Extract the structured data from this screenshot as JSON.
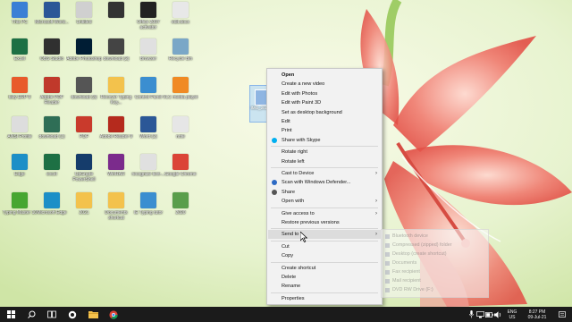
{
  "desktop_icons": [
    {
      "label": "This PC",
      "icon": "computer-icon",
      "color": "#3a7fd5"
    },
    {
      "label": "Microsoft Word...",
      "icon": "word-doc-icon",
      "color": "#2b5797"
    },
    {
      "label": "Untitled",
      "icon": "document-icon",
      "color": "#d0d0d0"
    },
    {
      "label": "",
      "icon": "keyboard-icon",
      "color": "#333333"
    },
    {
      "label": "Office 2007 activator",
      "icon": "archive-icon",
      "color": "#222222"
    },
    {
      "label": "edit.docx",
      "icon": "document-icon",
      "color": "#e8e8e8"
    },
    {
      "label": "Excel",
      "icon": "excel-icon",
      "color": "#1d7044"
    },
    {
      "label": "OBS Studio",
      "icon": "obs-icon",
      "color": "#303030"
    },
    {
      "label": "Adobe Photoshop",
      "icon": "photoshop-icon",
      "color": "#001d34"
    },
    {
      "label": "download (2)",
      "icon": "mouse-icon",
      "color": "#444444"
    },
    {
      "label": "Browser",
      "icon": "document-icon",
      "color": "#e0e0e0"
    },
    {
      "label": "Recycle Bin",
      "icon": "recycle-bin-icon",
      "color": "#7aa7c7"
    },
    {
      "label": "tally ERP 9",
      "icon": "tally-icon",
      "color": "#e85a2b"
    },
    {
      "label": "Adobe PDF Reader",
      "icon": "pdf-icon",
      "color": "#c0392b"
    },
    {
      "label": "download (3)",
      "icon": "printer-icon",
      "color": "#555555"
    },
    {
      "label": "Recover Typing Key...",
      "icon": "disk-icon",
      "color": "#f3c24c"
    },
    {
      "label": "Control Panel",
      "icon": "control-panel-icon",
      "color": "#3b8ed0"
    },
    {
      "label": "VLC media player",
      "icon": "vlc-icon",
      "color": "#f08a24"
    },
    {
      "label": "ANSI Profile",
      "icon": "document-icon",
      "color": "#dddddd"
    },
    {
      "label": "download (1)",
      "icon": "monitor-icon",
      "color": "#2f6e56"
    },
    {
      "label": "PDF",
      "icon": "pdf-icon",
      "color": "#c93a2c"
    },
    {
      "label": "Adobe Reader 9",
      "icon": "adobe-icon",
      "color": "#b52a1d"
    },
    {
      "label": "Word (2)",
      "icon": "word-doc-icon",
      "color": "#2b5797"
    },
    {
      "label": "note",
      "icon": "document-icon",
      "color": "#e6e6e6"
    },
    {
      "label": "Edge",
      "icon": "edge-icon",
      "color": "#1c8fc7"
    },
    {
      "label": "excel",
      "icon": "excel-icon",
      "color": "#1d7044"
    },
    {
      "label": "UpGrade PowerShell",
      "icon": "powershell-icon",
      "color": "#153c6b"
    },
    {
      "label": "WinRAR",
      "icon": "winrar-icon",
      "color": "#7b2b8c"
    },
    {
      "label": "recognize text-...",
      "icon": "document-icon",
      "color": "#e0e0e0"
    },
    {
      "label": "Google Chrome",
      "icon": "chrome-icon",
      "color": "#db4437"
    },
    {
      "label": "Typing Master 10",
      "icon": "typing-master-icon",
      "color": "#47a631"
    },
    {
      "label": "Microsoft Edge",
      "icon": "edge-icon",
      "color": "#1c8fc7"
    },
    {
      "label": "2021",
      "icon": "document-icon",
      "color": "#f3c24c"
    },
    {
      "label": "Documents shortcut",
      "icon": "folder-icon",
      "color": "#f3c24c"
    },
    {
      "label": "IE Typing tutor",
      "icon": "typing-tutor-icon",
      "color": "#3b8ed0"
    },
    {
      "label": "2020",
      "icon": "image-icon",
      "color": "#5a9e4b"
    }
  ],
  "selected_file": {
    "label": "IMG_2021..."
  },
  "context_menu": {
    "items": [
      {
        "label": "Open",
        "bold": true
      },
      {
        "label": "Create a new video"
      },
      {
        "label": "Edit with Photos"
      },
      {
        "label": "Edit with Paint 3D"
      },
      {
        "label": "Set as desktop background"
      },
      {
        "label": "Edit"
      },
      {
        "label": "Print"
      },
      {
        "label": "Share with Skype",
        "icon_color": "#00aff0"
      },
      {
        "sep": true
      },
      {
        "label": "Rotate right"
      },
      {
        "label": "Rotate left"
      },
      {
        "sep": true
      },
      {
        "label": "Cast to Device",
        "arrow": true
      },
      {
        "label": "Scan with Windows Defender...",
        "icon_color": "#2d6ac4"
      },
      {
        "label": "Share",
        "icon_color": "#555555"
      },
      {
        "label": "Open with",
        "arrow": true
      },
      {
        "sep": true
      },
      {
        "label": "Give access to",
        "arrow": true
      },
      {
        "label": "Restore previous versions"
      },
      {
        "sep": true
      },
      {
        "label": "Send to",
        "arrow": true,
        "hover": true
      },
      {
        "sep": true
      },
      {
        "label": "Cut"
      },
      {
        "label": "Copy"
      },
      {
        "sep": true
      },
      {
        "label": "Create shortcut"
      },
      {
        "label": "Delete"
      },
      {
        "label": "Rename"
      },
      {
        "sep": true
      },
      {
        "label": "Properties"
      }
    ]
  },
  "send_to_menu": {
    "items": [
      "Bluetooth device",
      "Compressed (zipped) folder",
      "Desktop (create shortcut)",
      "Documents",
      "Fax recipient",
      "Mail recipient",
      "DVD RW Drive (F:)"
    ]
  },
  "taskbar": {
    "icons": [
      "windows-start-icon",
      "search-icon",
      "task-view-icon",
      "file-explorer-icon",
      "chrome-icon"
    ],
    "tray": {
      "language": "ENG",
      "region": "US",
      "time": "8:27 PM",
      "date": "09-Jul-21"
    }
  },
  "colors": {
    "taskbar": "#1b1b1b",
    "menu_bg": "#f2f2f2",
    "menu_hover": "#dcdcdc",
    "flower": "#e8534a"
  }
}
